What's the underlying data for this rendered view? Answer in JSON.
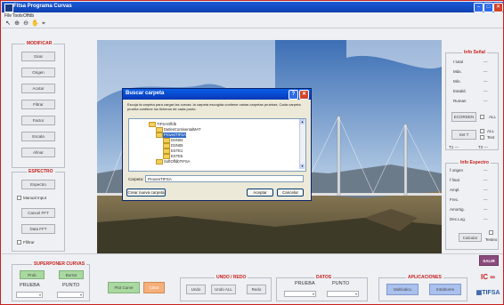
{
  "window": {
    "title": "Fitsa Programa Curvas"
  },
  "menu": [
    "File",
    "Tools",
    "Offdb"
  ],
  "toolbar": {
    "icons": [
      "pointer-icon",
      "zoom-in-icon",
      "zoom-out-icon",
      "pan-icon",
      "data-cursor-icon"
    ]
  },
  "modificar": {
    "title": "MODIFICAR",
    "buttons": [
      "Girar",
      "Origen",
      "Acotar",
      "Filtrar",
      "Factor",
      "Escala",
      "Afinar"
    ]
  },
  "espectro": {
    "title": "ESPECTRO",
    "buttons": [
      "Espectro",
      "Manual Input",
      "Cancel FFT",
      "Data FFT",
      "Ffiltrar"
    ]
  },
  "superponer": {
    "title": "SUPERPONER CURVAS",
    "btn1": "Prob",
    "btn2": "Borrar",
    "col1": "PRUEBA",
    "col2": "PUNTO"
  },
  "center_buttons": {
    "plot_curve": "Plot Curve",
    "clear": "Clear"
  },
  "undo": {
    "title": "UNDO / REDO",
    "undo": "Undo",
    "undo_all": "Undo ALL",
    "redo": "Redo"
  },
  "datos": {
    "title": "DATOS",
    "col1": "PRUEBA",
    "col2": "PUNTO"
  },
  "aplicaciones": {
    "title": "APLICACIONES",
    "btn1": "Multicalcu",
    "btn2": "Intrahores"
  },
  "info_senal": {
    "title": "Info Señal",
    "rows": [
      {
        "label": "t total",
        "value": "---"
      },
      {
        "label": "Máx.",
        "value": "---"
      },
      {
        "label": "Mín.",
        "value": "---"
      },
      {
        "label": "Estabil.",
        "value": "---"
      },
      {
        "label": "Ruman",
        "value": "---"
      }
    ],
    "btn_ecorden": "ECORDEN",
    "btn_set": "Set T",
    "all_label": "ALL",
    "all_label2": "ALL",
    "text_label": "Text",
    "t1": "T1 ---",
    "t2": "T2 ---"
  },
  "info_espectro": {
    "title": "Info Espectro",
    "rows": [
      {
        "label": "f origen",
        "value": "---"
      },
      {
        "label": "f final",
        "value": "---"
      },
      {
        "label": "Ampl.",
        "value": "---"
      },
      {
        "label": "Frec.",
        "value": "---"
      },
      {
        "label": "Amortig.",
        "value": "---"
      },
      {
        "label": "Dec.Log.",
        "value": "---"
      }
    ],
    "btn_calcular": "Calcular",
    "testeo": "Testeo"
  },
  "side_buttons": {
    "salir": "SALIR",
    "logo1": "IC ∞",
    "logo2": "▦TIFSA"
  },
  "dialog": {
    "title": "Buscar carpeta",
    "instructions": "Escoja la carpeta para cargar las curvas: la carpeta escogida contiene varias carpetas pruebas. Cada carpeta prueba contiene los ficheros de cada punto.",
    "tree": [
      {
        "label": "TIFSAOffdb",
        "depth": 0,
        "selected": false
      },
      {
        "label": "DatlesContinentalMAT",
        "depth": 1,
        "selected": false
      },
      {
        "label": "ProvesTIFSA",
        "depth": 1,
        "selected": true
      },
      {
        "label": "DSN04",
        "depth": 2,
        "selected": false
      },
      {
        "label": "DSN05",
        "depth": 2,
        "selected": false
      },
      {
        "label": "ESTE1",
        "depth": 2,
        "selected": false
      },
      {
        "label": "ESTE5",
        "depth": 2,
        "selected": false
      },
      {
        "label": "SoftOffdbTIFSA",
        "depth": 1,
        "selected": false
      }
    ],
    "folder_label": "Carpeta:",
    "folder_value": "ProvesTIFSA",
    "new_folder": "Crear nueva carpeta",
    "ok": "Aceptar",
    "cancel": "Cancelar"
  }
}
